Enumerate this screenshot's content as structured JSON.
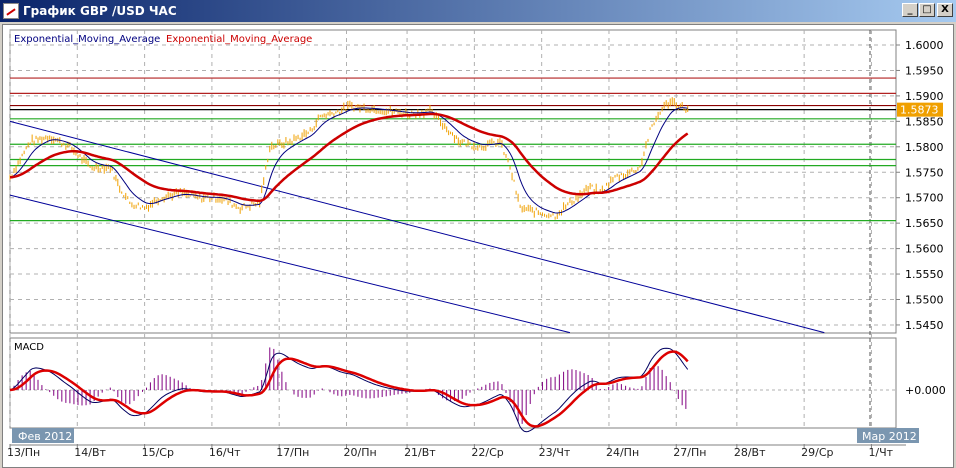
{
  "window": {
    "title": "График GBP /USD ЧАС",
    "minimize": "_",
    "maximize": "□",
    "close": "X"
  },
  "legend": {
    "ema1": "Exponential_Moving_Average",
    "ema2": "Exponential_Moving_Average",
    "ema1_color": "#000080",
    "ema2_color": "#cc0000"
  },
  "price_axis": {
    "ticks": [
      "1.6000",
      "1.5950",
      "1.5900",
      "1.5850",
      "1.5800",
      "1.5750",
      "1.5700",
      "1.5650",
      "1.5600",
      "1.5550",
      "1.5500",
      "1.5450"
    ],
    "tick_values": [
      1.6,
      1.595,
      1.59,
      1.585,
      1.58,
      1.575,
      1.57,
      1.565,
      1.56,
      1.555,
      1.55,
      1.545
    ],
    "current": "1.5873",
    "current_value": 1.5873
  },
  "levels": [
    {
      "v": 1.5935,
      "c": "#b22222"
    },
    {
      "v": 1.5905,
      "c": "#b22222"
    },
    {
      "v": 1.5881,
      "c": "#8b0000"
    },
    {
      "v": 1.5873,
      "c": "#000000"
    },
    {
      "v": 1.5855,
      "c": "#22aa22"
    },
    {
      "v": 1.5805,
      "c": "#22aa22"
    },
    {
      "v": 1.5775,
      "c": "#22aa22"
    },
    {
      "v": 1.5763,
      "c": "#22aa22"
    },
    {
      "v": 1.5655,
      "c": "#22aa22"
    }
  ],
  "channel": [
    {
      "t0": 0,
      "p0": 1.585,
      "t1": 12.1,
      "p1": 1.5435
    },
    {
      "t0": 0,
      "p0": 1.5705,
      "t1": 8.32,
      "p1": 1.5435
    }
  ],
  "price_series": [
    [
      0,
      1.574
    ],
    [
      0.3,
      1.581
    ],
    [
      0.59,
      1.582
    ],
    [
      0.89,
      1.58
    ],
    [
      1.19,
      1.576
    ],
    [
      1.49,
      1.576
    ],
    [
      1.63,
      1.572
    ],
    [
      1.78,
      1.569
    ],
    [
      2.0,
      1.568
    ],
    [
      2.23,
      1.57
    ],
    [
      2.53,
      1.571
    ],
    [
      2.82,
      1.57
    ],
    [
      3.12,
      1.57
    ],
    [
      3.42,
      1.568
    ],
    [
      3.71,
      1.569
    ],
    [
      3.86,
      1.58
    ],
    [
      4.16,
      1.581
    ],
    [
      4.46,
      1.583
    ],
    [
      4.61,
      1.586
    ],
    [
      4.9,
      1.587
    ],
    [
      5.05,
      1.588
    ],
    [
      5.35,
      1.5875
    ],
    [
      5.65,
      1.587
    ],
    [
      5.94,
      1.5865
    ],
    [
      6.24,
      1.587
    ],
    [
      6.46,
      1.584
    ],
    [
      6.69,
      1.581
    ],
    [
      6.98,
      1.58
    ],
    [
      7.28,
      1.581
    ],
    [
      7.43,
      1.576
    ],
    [
      7.58,
      1.568
    ],
    [
      7.88,
      1.567
    ],
    [
      8.1,
      1.5665
    ],
    [
      8.32,
      1.569
    ],
    [
      8.62,
      1.572
    ],
    [
      8.77,
      1.571
    ],
    [
      8.99,
      1.574
    ],
    [
      9.21,
      1.575
    ],
    [
      9.36,
      1.576
    ],
    [
      9.51,
      1.583
    ],
    [
      9.66,
      1.587
    ],
    [
      9.81,
      1.589
    ],
    [
      9.96,
      1.588
    ],
    [
      10.07,
      1.5873
    ]
  ],
  "macd": {
    "label": "MACD",
    "zero": "+0.000"
  },
  "time_axis": {
    "days": [
      "13/Пн",
      "14/Вт",
      "15/Ср",
      "16/Чт",
      "17/Пн",
      "20/Пн",
      "21/Вт",
      "22/Ср",
      "23/Чт",
      "24/Пн",
      "27/Пн",
      "28/Вт",
      "29/Ср",
      "1/Чт"
    ],
    "day_t": [
      0,
      1,
      2,
      3,
      4,
      5,
      5.9,
      6.9,
      7.9,
      8.9,
      9.9,
      10.8,
      11.8,
      12.8
    ],
    "month1": "Фев 2012",
    "month2": "Мар 2012"
  },
  "colors": {
    "price": "#f0a000",
    "grid": "#b0b0b0",
    "channel": "#000099",
    "hist": "#800080"
  }
}
